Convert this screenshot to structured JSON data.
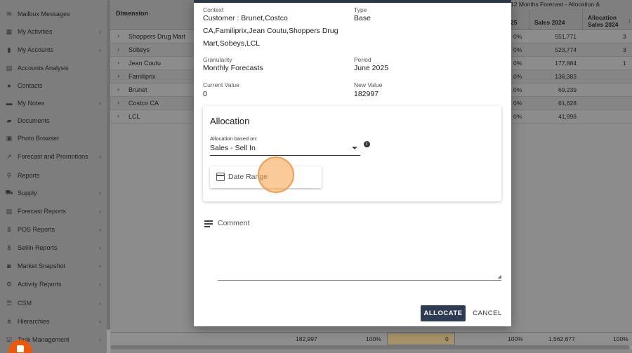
{
  "sidebar": {
    "items": [
      {
        "label": "Mailbox Messages",
        "icon": "envelope-icon",
        "glyph": "✉",
        "chevron": false
      },
      {
        "label": "My Activities",
        "icon": "calendar-icon",
        "glyph": "▦",
        "chevron": true
      },
      {
        "label": "My Accounts",
        "icon": "building-icon",
        "glyph": "▮",
        "chevron": true
      },
      {
        "label": "Accounts Analysis",
        "icon": "table-icon",
        "glyph": "▤",
        "chevron": false
      },
      {
        "label": "Contacts",
        "icon": "person-icon",
        "glyph": "●",
        "chevron": false
      },
      {
        "label": "My Notes",
        "icon": "note-icon",
        "glyph": "▬",
        "chevron": true
      },
      {
        "label": "Documents",
        "icon": "folder-icon",
        "glyph": "▰",
        "chevron": false
      },
      {
        "label": "Photo Browser",
        "icon": "photo-icon",
        "glyph": "▣",
        "chevron": false
      },
      {
        "label": "Forecast and Promotions",
        "icon": "chart-line-icon",
        "glyph": "↗",
        "chevron": true
      },
      {
        "label": "Reports",
        "icon": "search-icon",
        "glyph": "⚲",
        "chevron": false
      },
      {
        "label": "Supply",
        "icon": "truck-icon",
        "glyph": "⛟",
        "chevron": true
      },
      {
        "label": "Forecast Reports",
        "icon": "table-icon",
        "glyph": "▤",
        "chevron": true
      },
      {
        "label": "POS Reports",
        "icon": "dollar-icon",
        "glyph": "$",
        "chevron": true
      },
      {
        "label": "SellIn Reports",
        "icon": "dollar-icon",
        "glyph": "$",
        "chevron": true
      },
      {
        "label": "Market Snapshot",
        "icon": "camera-icon",
        "glyph": "◙",
        "chevron": true
      },
      {
        "label": "Activity Reports",
        "icon": "gear-icon",
        "glyph": "⚙",
        "chevron": true
      },
      {
        "label": "CSM",
        "icon": "list-icon",
        "glyph": "☰",
        "chevron": true
      },
      {
        "label": "Hierarchies",
        "icon": "hierarchy-icon",
        "glyph": "⋔",
        "chevron": true
      },
      {
        "label": "Task Management",
        "icon": "tasks-icon",
        "glyph": "☑",
        "chevron": true
      }
    ]
  },
  "grid": {
    "dimension_header": "Dimension",
    "forecast_header": "12 Months Forecast - Allocation &",
    "col_25": "25",
    "col_sales": "Sales 2024",
    "col_alloc": "Allocation Sales 2024",
    "sort_arrow": "↓",
    "rows": [
      {
        "name": "Shoppers Drug Mart",
        "pct": "0%",
        "sales": "551,771",
        "tail": "3"
      },
      {
        "name": "Sobeys",
        "pct": "0%",
        "sales": "523,774",
        "tail": "3"
      },
      {
        "name": "Jean Coutu",
        "pct": "0%",
        "sales": "177,884",
        "tail": "1"
      },
      {
        "name": "Familiprix",
        "pct": "0%",
        "sales": "136,383",
        "tail": ""
      },
      {
        "name": "Brunet",
        "pct": "0%",
        "sales": "69,239",
        "tail": ""
      },
      {
        "name": "Costco CA",
        "pct": "0%",
        "sales": "61,628",
        "tail": ""
      },
      {
        "name": "LCL",
        "pct": "0%",
        "sales": "41,998",
        "tail": ""
      }
    ],
    "footer": {
      "total": "182,997",
      "pct1": "100%",
      "alloc_value": "0",
      "pct2": "100%",
      "sales_total": "1,562,677",
      "pct3": "100%"
    }
  },
  "modal": {
    "context_label": "Context",
    "context_value": "Customer : Brunet,Costco CA,Familiprix,Jean Coutu,Shoppers Drug Mart,Sobeys,LCL",
    "type_label": "Type",
    "type_value": "Base",
    "granularity_label": "Granularity",
    "granularity_value": "Monthly Forecasts",
    "period_label": "Period",
    "period_value": "June 2025",
    "current_label": "Current Value",
    "current_value": "0",
    "new_label": "New Value",
    "new_value": "182997",
    "allocation": {
      "title": "Allocation",
      "based_on_label": "Allocation based on:",
      "based_on_value": "Sales - Sell In",
      "info_glyph": "i",
      "date_range_label": "Date Range"
    },
    "comment_placeholder": "Comment",
    "allocate_label": "ALLOCATE",
    "cancel_label": "CANCEL"
  },
  "colors": {
    "primary": "#2d3c52",
    "accent_highlight": "#f5a046",
    "fab": "#e8590c"
  }
}
